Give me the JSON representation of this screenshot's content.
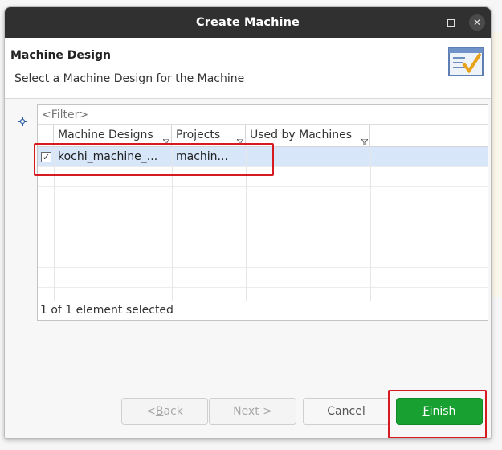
{
  "dialog": {
    "title": "Create Machine",
    "header_title": "Machine Design",
    "header_description": "Select a Machine Design for the Machine"
  },
  "filter": {
    "placeholder": "<Filter>"
  },
  "table": {
    "columns": [
      "Machine Designs",
      "Projects",
      "Used by Machines"
    ],
    "rows": [
      {
        "checked": true,
        "cells": [
          "kochi_machine_...",
          "machin...",
          ""
        ]
      }
    ],
    "status": "1 of 1 element selected"
  },
  "buttons": {
    "back": {
      "prefix": "< ",
      "mnemonic": "B",
      "rest": "ack"
    },
    "next": "Next >",
    "cancel": "Cancel",
    "finish": {
      "mnemonic": "F",
      "rest": "inish"
    }
  },
  "colors": {
    "titlebar": "#303030",
    "finish_button": "#18a031",
    "annotation": "#d61a20",
    "selected_row": "#d7e7f9"
  },
  "icons": [
    "maximize-icon",
    "close-icon",
    "wizard-checklist-icon",
    "add-plus-icon",
    "filter-funnel-icon",
    "checkbox-checked-icon"
  ]
}
